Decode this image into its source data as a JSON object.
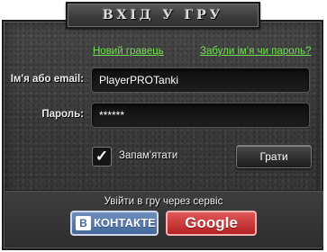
{
  "header": {
    "title": "ВХІД У ГРУ"
  },
  "links": {
    "new_player": "Новий гравець",
    "forgot": "Забули ім'я чи пароль?"
  },
  "form": {
    "login_label": "Ім'я або email:",
    "login_value": "PlayerPROTanki",
    "password_label": "Пароль:",
    "password_value": "******",
    "remember_label": "Запам'ятати",
    "remember_checked": true,
    "checkbox_mark": "✓",
    "play_button": "Грати"
  },
  "social": {
    "title": "Увійти в гру через сервіс",
    "vk_badge": "В",
    "vk_label": "КОНТАКТЕ",
    "google_label": "Google"
  },
  "colors": {
    "link": "#6fe04e",
    "vk": "#45689c",
    "google": "#c62b2b",
    "panel": "#3a3a3a"
  }
}
